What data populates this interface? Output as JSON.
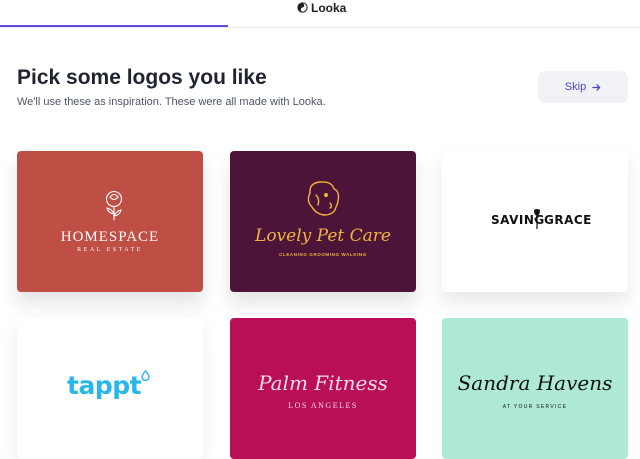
{
  "header": {
    "brand": "Looka",
    "progress_fraction": 0.356
  },
  "page": {
    "title": "Pick some logos you like",
    "subtitle": "We'll use these as inspiration. These were all made with Looka.",
    "skip_label": "Skip"
  },
  "logos": [
    {
      "name": "HOMESPACE",
      "tagline": "REAL ESTATE",
      "background": "#bf4f44",
      "icon": "rose-icon"
    },
    {
      "name": "Lovely Pet Care",
      "tagline": "CLEANING  GROOMING  WALKING",
      "background": "#4c1439",
      "icon": "dog-icon"
    },
    {
      "name_left": "SAVING",
      "name_right": "GRACE",
      "background": "#ffffff",
      "icon": "rose-stem-icon"
    },
    {
      "name": "tappt",
      "background": "#ffffff",
      "icon": "droplet-icon"
    },
    {
      "name": "Palm Fitness",
      "tagline": "LOS ANGELES",
      "background": "#b90f57"
    },
    {
      "name": "Sandra Havens",
      "tagline": "AT YOUR SERVICE",
      "background": "#aee9d8"
    }
  ],
  "colors": {
    "accent": "#5b4bdb",
    "skip_text": "#4d44c9"
  }
}
